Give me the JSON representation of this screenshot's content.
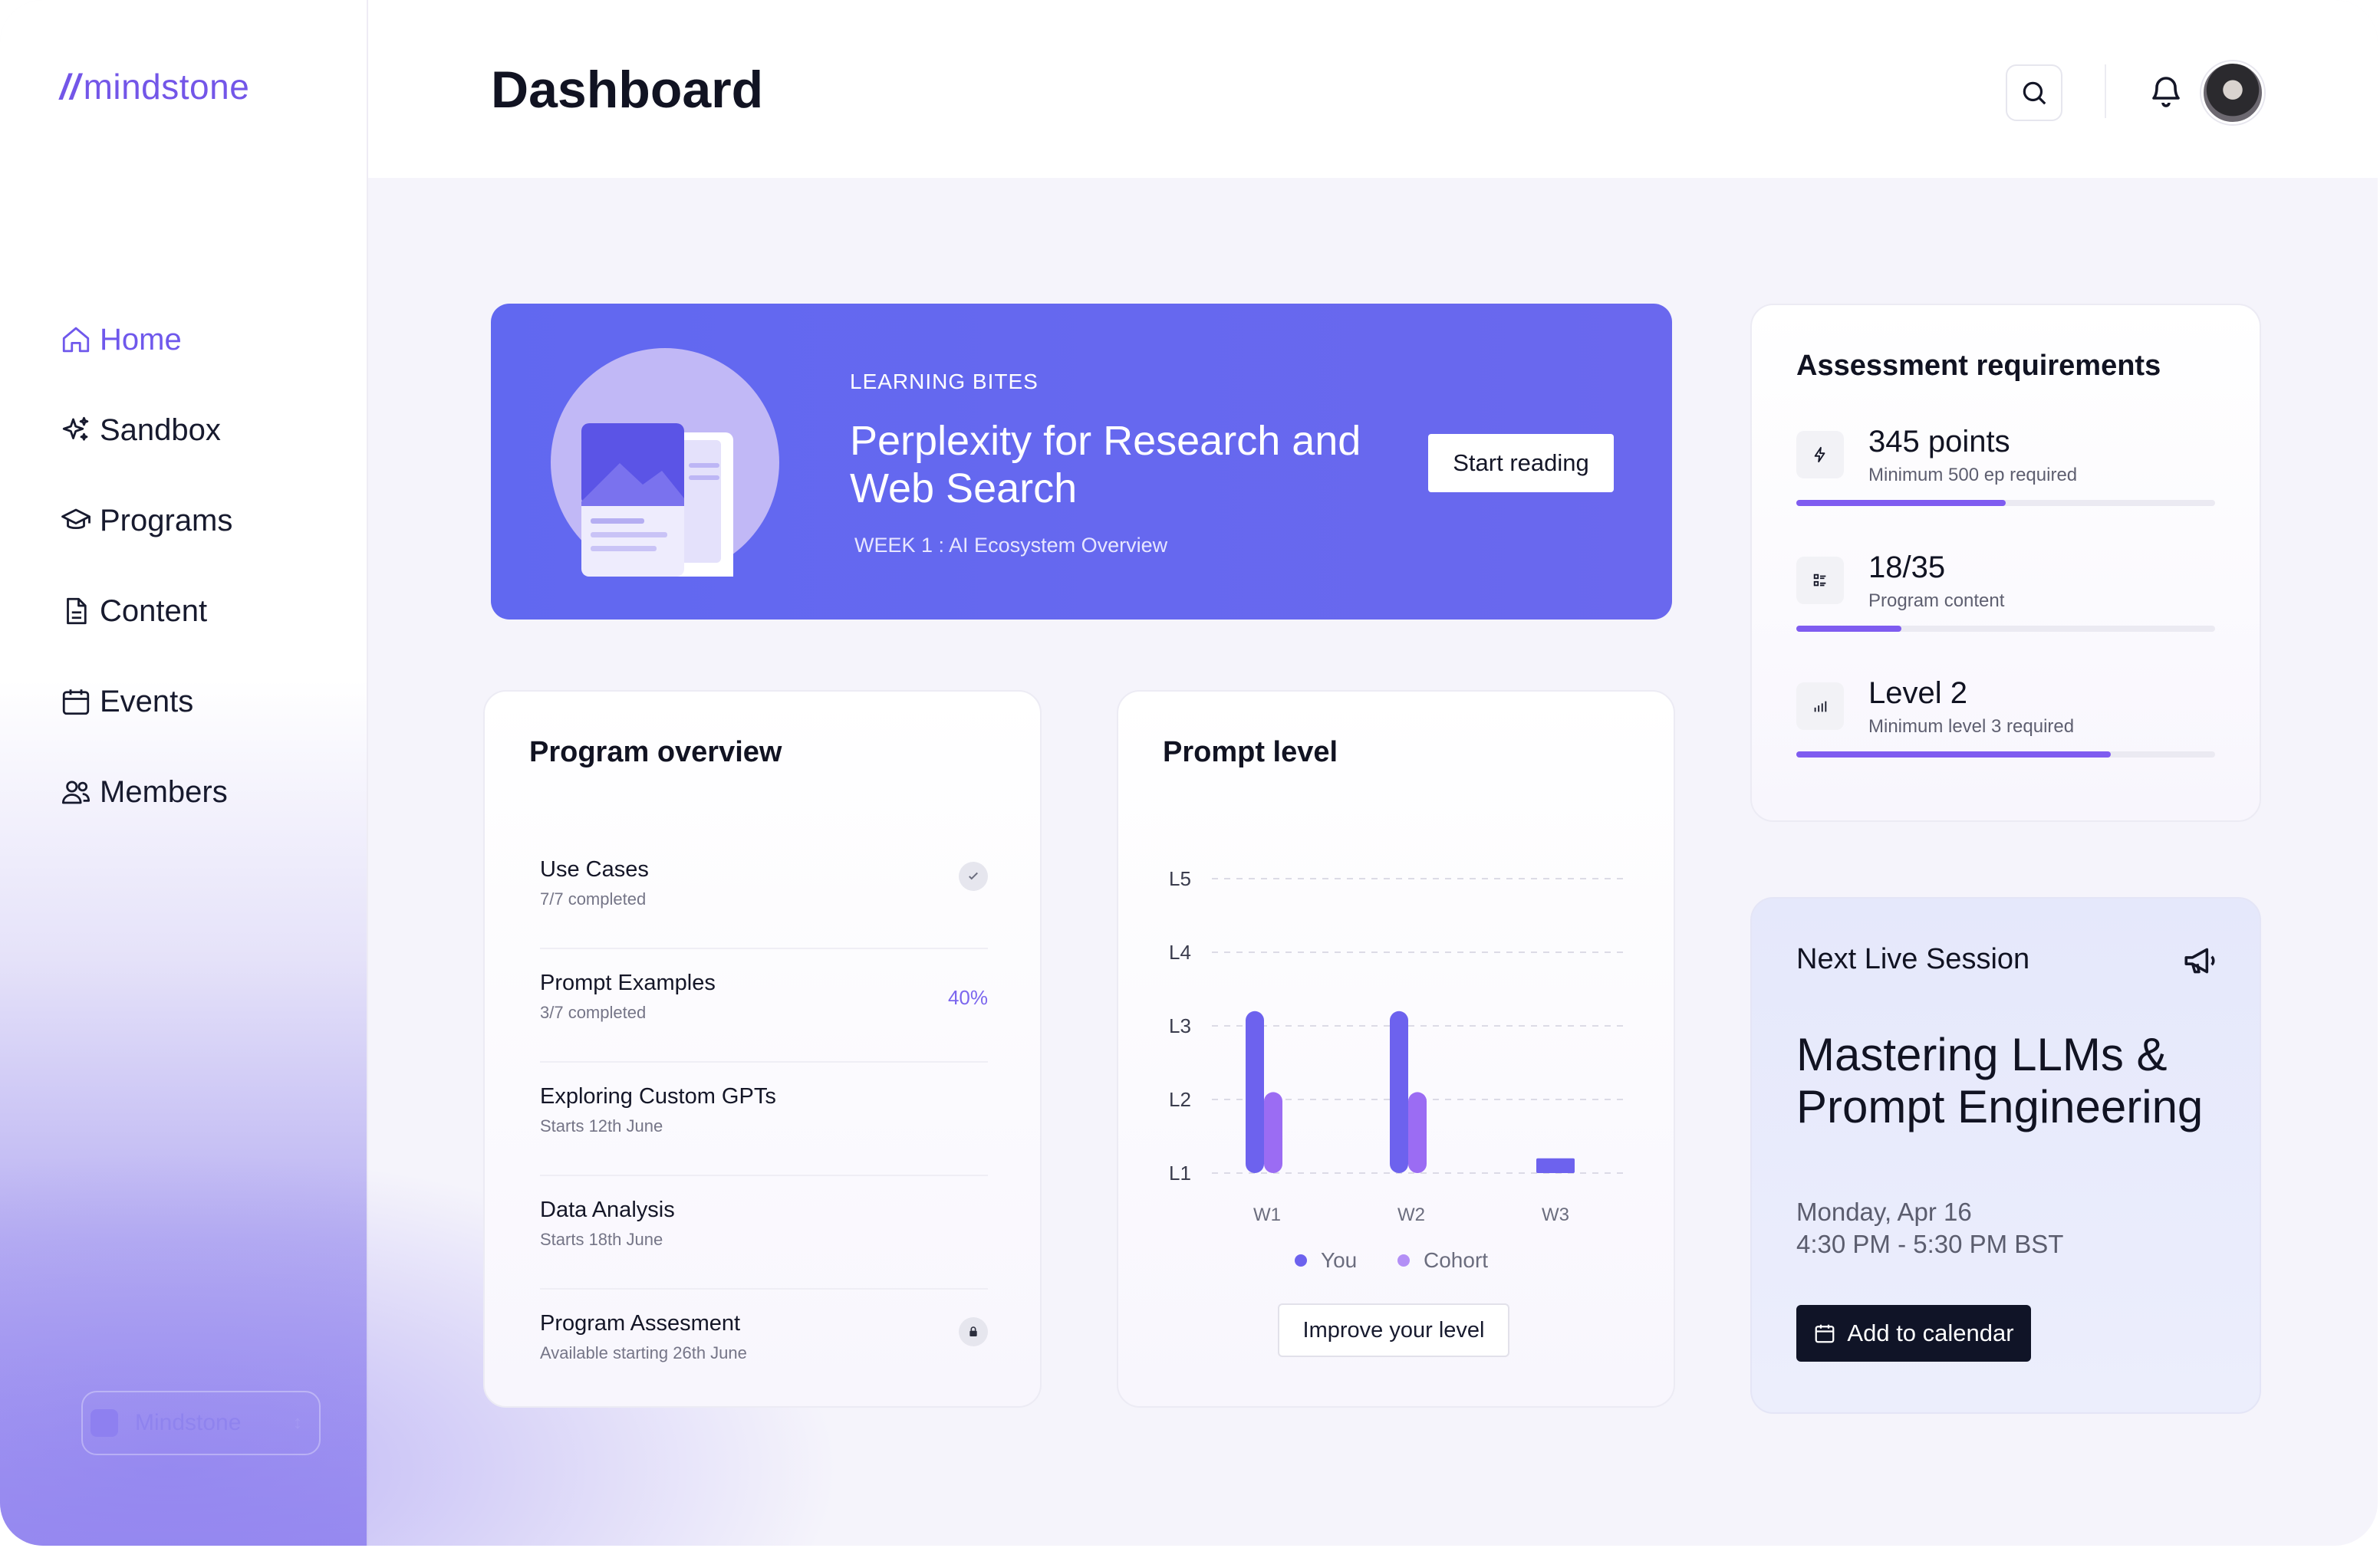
{
  "app": {
    "logo_text": "mindstone",
    "logo_mark": "//"
  },
  "sidebar": {
    "items": [
      {
        "label": "Home",
        "icon": "home-icon",
        "active": true
      },
      {
        "label": "Sandbox",
        "icon": "sparkles-icon",
        "active": false
      },
      {
        "label": "Programs",
        "icon": "graduation-cap-icon",
        "active": false
      },
      {
        "label": "Content",
        "icon": "document-icon",
        "active": false
      },
      {
        "label": "Events",
        "icon": "calendar-icon",
        "active": false
      },
      {
        "label": "Members",
        "icon": "users-icon",
        "active": false
      }
    ],
    "workspace": "Mindstone"
  },
  "header": {
    "title": "Dashboard",
    "search_icon": "search-icon",
    "bell_icon": "bell-icon"
  },
  "hero": {
    "tag": "LEARNING BITES",
    "title": "Perplexity for Research and Web Search",
    "week": "WEEK 1 : AI Ecosystem Overview",
    "button": "Start reading"
  },
  "program_overview": {
    "title": "Program overview",
    "items": [
      {
        "name": "Use Cases",
        "sub": "7/7 completed",
        "status": "check"
      },
      {
        "name": "Prompt Examples",
        "sub": "3/7 completed",
        "status": "40%"
      },
      {
        "name": "Exploring Custom GPTs",
        "sub": "Starts 12th June",
        "status": ""
      },
      {
        "name": "Data Analysis",
        "sub": "Starts 18th June",
        "status": ""
      },
      {
        "name": "Program Assesment",
        "sub": "Available starting 26th June",
        "status": "lock"
      }
    ]
  },
  "prompt_level": {
    "title": "Prompt level",
    "button": "Improve your level"
  },
  "chart_data": {
    "type": "bar",
    "title": "Prompt level",
    "categories": [
      "W1",
      "W2",
      "W3"
    ],
    "y_ticks": [
      "L1",
      "L2",
      "L3",
      "L4",
      "L5"
    ],
    "ylim": [
      1,
      5
    ],
    "series": [
      {
        "name": "You",
        "values": [
          3.2,
          3.2,
          1.2
        ],
        "color": "#6d62ee"
      },
      {
        "name": "Cohort",
        "values": [
          2.1,
          2.1,
          null
        ],
        "color": "#9b6cf3"
      }
    ],
    "legend": "bottom",
    "grid": true
  },
  "assessment": {
    "title": "Assessment requirements",
    "items": [
      {
        "value": "345 points",
        "sub": "Minimum 500 ep required",
        "progress": 0.5,
        "icon": "bolt-icon"
      },
      {
        "value": "18/35",
        "sub": "Program content",
        "progress": 0.25,
        "icon": "list-icon"
      },
      {
        "value": "Level 2",
        "sub": "Minimum level 3 required",
        "progress": 0.75,
        "icon": "bar-chart-icon"
      }
    ]
  },
  "session": {
    "label": "Next Live Session",
    "title": "Mastering LLMs & Prompt Engineering",
    "date": "Monday, Apr 16",
    "time": "4:30 PM - 5:30 PM BST",
    "button": "Add to calendar"
  }
}
